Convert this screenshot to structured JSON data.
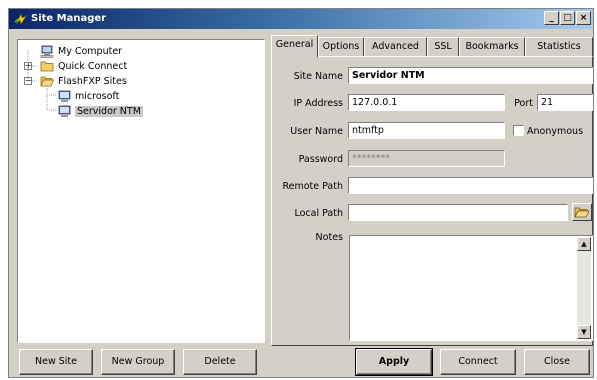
{
  "window": {
    "title": "Site Manager",
    "controls": {
      "minimize": "_",
      "maximize": "□",
      "close": "×"
    }
  },
  "tree": {
    "items": [
      {
        "label": "My Computer",
        "icon": "computer-icon"
      },
      {
        "label": "Quick Connect",
        "icon": "folder-icon",
        "expander": "+"
      },
      {
        "label": "FlashFXP Sites",
        "icon": "folder-icon",
        "expander": "−"
      },
      {
        "label": "microsoft",
        "icon": "site-icon"
      },
      {
        "label": "Servidor NTM",
        "icon": "site-icon",
        "selected": true
      }
    ]
  },
  "tabs": [
    "General",
    "Options",
    "Advanced",
    "SSL",
    "Bookmarks",
    "Statistics"
  ],
  "active_tab": "General",
  "form": {
    "site_name_label": "Site Name",
    "site_name_value": "Servidor NTM",
    "ip_label": "IP Address",
    "ip_value": "127.0.0.1",
    "port_label": "Port",
    "port_value": "21",
    "user_label": "User Name",
    "user_value": "ntmftp",
    "anonymous_label": "Anonymous",
    "password_label": "Password",
    "password_value": "********",
    "remote_path_label": "Remote Path",
    "remote_path_value": "",
    "local_path_label": "Local Path",
    "local_path_value": "",
    "notes_label": "Notes",
    "notes_value": ""
  },
  "buttons": {
    "new_site": "New Site",
    "new_group": "New Group",
    "delete": "Delete",
    "apply": "Apply",
    "connect": "Connect",
    "close": "Close"
  },
  "colors": {
    "titlebar_start": "#0a246a",
    "titlebar_end": "#a6caf0",
    "face": "#d4d0c8"
  }
}
